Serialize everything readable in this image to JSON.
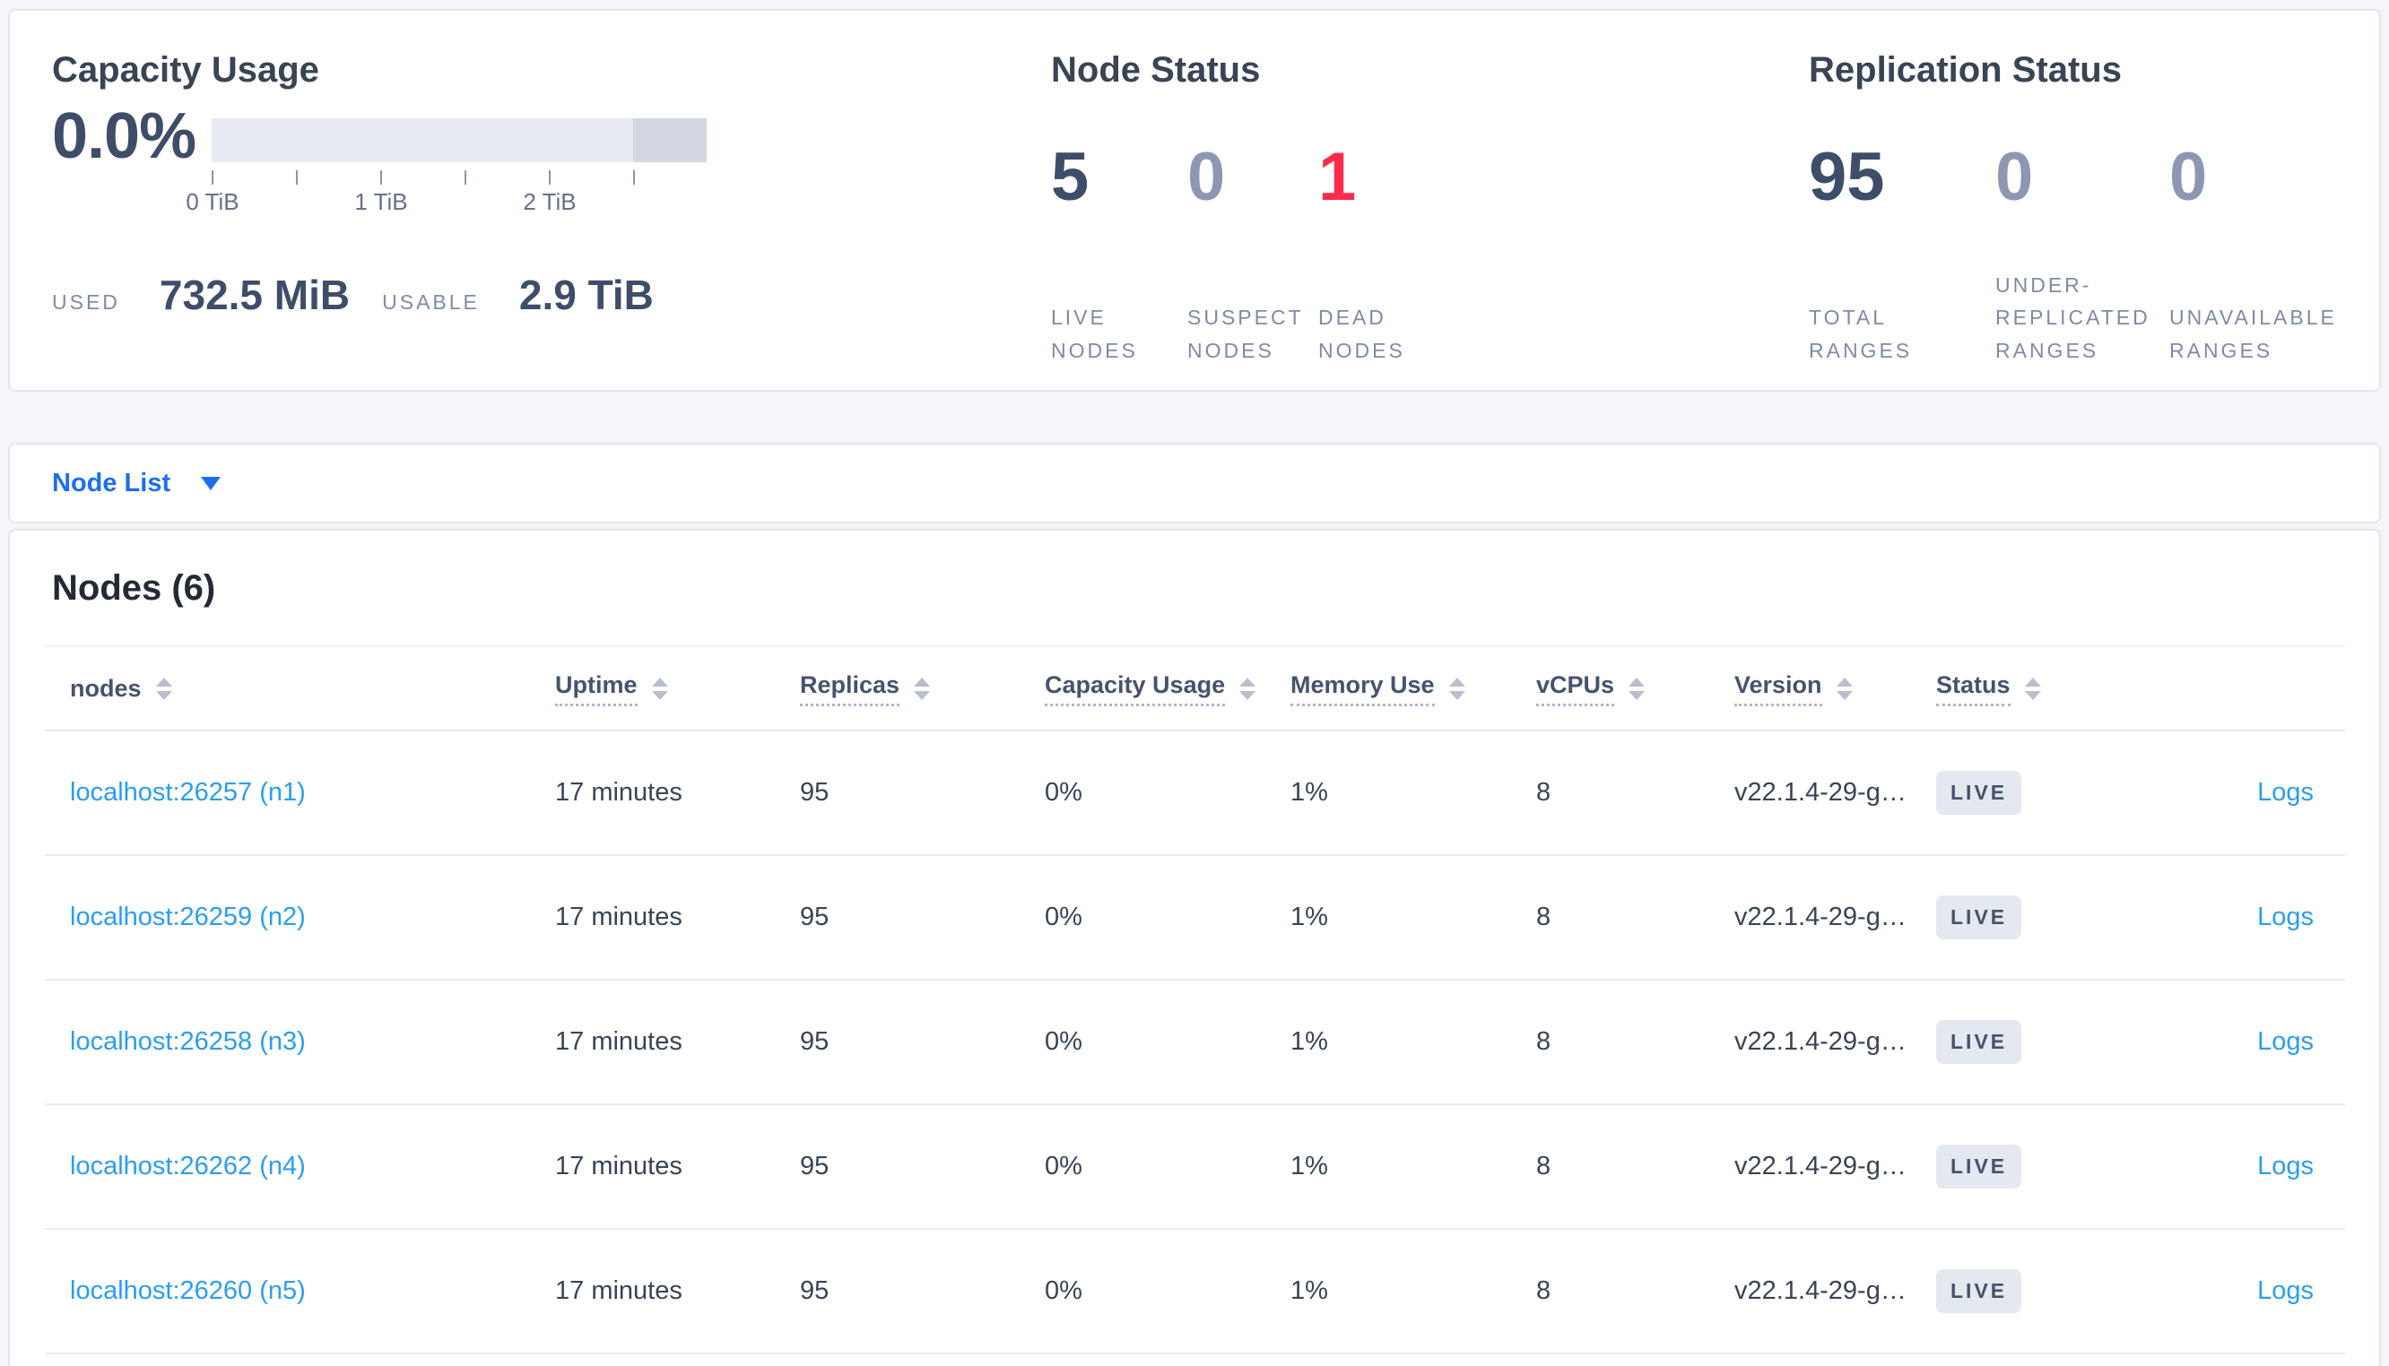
{
  "colors": {
    "page-bg": "#f4f6fa",
    "border": "#e2e7f0",
    "divider": "#e8ebf1",
    "title": "#394455",
    "heading": "#242a35",
    "stat-dark": "#3e4d69",
    "stat-muted": "#8d97b1",
    "stat-red": "#ff2b4b",
    "label-muted": "#7f8ba4",
    "bar-track": "#e8eaf1",
    "bar-seg": "#d3d7e2",
    "tick": "#8a95ad",
    "tick-label": "#64718e",
    "accent": "#1b6ff2",
    "table-link": "#2a9df4",
    "header-text": "#47536e",
    "row-text": "#394455",
    "dotted": "#a9b7d2",
    "sort": "#b9bfcc",
    "badge-bg": "#e4e8ef",
    "badge-text": "#44536b"
  },
  "capacity": {
    "title": "Capacity Usage",
    "percent": "0.0%",
    "bar": {
      "segment_start_pct": 85.1
    },
    "tick_labels": [
      "0 TiB",
      "1 TiB",
      "2 TiB"
    ],
    "used_label": "USED",
    "used_value": "732.5 MiB",
    "usable_label": "USABLE",
    "usable_value": "2.9 TiB"
  },
  "node_status": {
    "title": "Node Status",
    "stats": [
      {
        "value": "5",
        "label": "LIVE NODES"
      },
      {
        "value": "0",
        "label": "SUSPECT NODES"
      },
      {
        "value": "1",
        "label": "DEAD NODES"
      }
    ]
  },
  "replication": {
    "title": "Replication Status",
    "stats": [
      {
        "value": "95",
        "label": "TOTAL RANGES"
      },
      {
        "value": "0",
        "label": "UNDER-REPLICATED RANGES"
      },
      {
        "value": "0",
        "label": "UNAVAILABLE RANGES"
      }
    ]
  },
  "view_selector": {
    "label": "Node List"
  },
  "nodes_section": {
    "title": "Nodes (6)",
    "columns": [
      {
        "label": "nodes"
      },
      {
        "label": "Uptime"
      },
      {
        "label": "Replicas"
      },
      {
        "label": "Capacity Usage"
      },
      {
        "label": "Memory Use"
      },
      {
        "label": "vCPUs"
      },
      {
        "label": "Version"
      },
      {
        "label": "Status"
      }
    ],
    "rows": [
      {
        "node": "localhost:26257 (n1)",
        "uptime": "17 minutes",
        "replicas": "95",
        "capacity_usage": "0%",
        "memory_use": "1%",
        "vcpus": "8",
        "version": "v22.1.4-29-g…",
        "status": "LIVE",
        "logs": "Logs"
      },
      {
        "node": "localhost:26259 (n2)",
        "uptime": "17 minutes",
        "replicas": "95",
        "capacity_usage": "0%",
        "memory_use": "1%",
        "vcpus": "8",
        "version": "v22.1.4-29-g…",
        "status": "LIVE",
        "logs": "Logs"
      },
      {
        "node": "localhost:26258 (n3)",
        "uptime": "17 minutes",
        "replicas": "95",
        "capacity_usage": "0%",
        "memory_use": "1%",
        "vcpus": "8",
        "version": "v22.1.4-29-g…",
        "status": "LIVE",
        "logs": "Logs"
      },
      {
        "node": "localhost:26262 (n4)",
        "uptime": "17 minutes",
        "replicas": "95",
        "capacity_usage": "0%",
        "memory_use": "1%",
        "vcpus": "8",
        "version": "v22.1.4-29-g…",
        "status": "LIVE",
        "logs": "Logs"
      },
      {
        "node": "localhost:26260 (n5)",
        "uptime": "17 minutes",
        "replicas": "95",
        "capacity_usage": "0%",
        "memory_use": "1%",
        "vcpus": "8",
        "version": "v22.1.4-29-g…",
        "status": "LIVE",
        "logs": "Logs"
      }
    ]
  }
}
